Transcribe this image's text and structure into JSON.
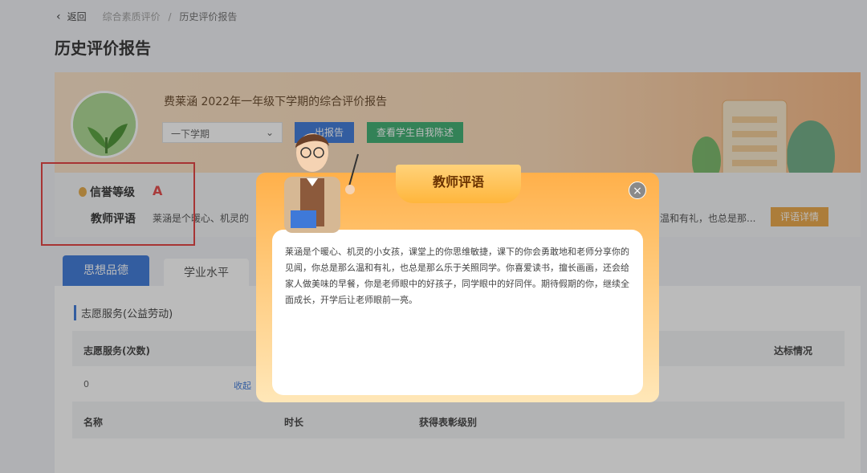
{
  "nav": {
    "back_label": "返回",
    "breadcrumb": [
      "综合素质评价",
      "历史评价报告"
    ],
    "separator": "/"
  },
  "page_title": "历史评价报告",
  "report": {
    "title": "费莱涵  2022年一年级下学期的综合评价报告",
    "semester_value": "一下学期",
    "btn_export": "出报告",
    "btn_self_statement": "查看学生自我陈述"
  },
  "credit": {
    "label": "信誉等级",
    "value": "A"
  },
  "teacher_comment": {
    "label": "教师评语",
    "preview": "莱涵是个暖心、机灵的",
    "preview_tail": "温和有礼，也总是那...",
    "detail_button": "评语详情"
  },
  "tabs": [
    "思想品德",
    "学业水平"
  ],
  "section": {
    "title": "志愿服务(公益劳动)",
    "table1": {
      "headers": [
        "志愿服务(次数)",
        "达标情况"
      ],
      "row": [
        "0",
        "收起"
      ]
    },
    "table2": {
      "headers": [
        "名称",
        "时长",
        "获得表彰级别"
      ]
    }
  },
  "modal": {
    "title": "教师评语",
    "close": "×",
    "text": "莱涵是个暖心、机灵的小女孩，课堂上的你思维敏捷，课下的你会勇敢地和老师分享你的见闻，你总是那么温和有礼，也总是那么乐于关照同学。你喜爱读书，擅长画画，还会给家人做美味的早餐，你是老师眼中的好孩子，同学眼中的好同伴。期待假期的你，继续全面成长，开学后让老师眼前一亮。"
  },
  "colors": {
    "primary": "#2f6fd6",
    "green": "#2fa866",
    "orange": "#e8a03a",
    "danger": "#e23b3b"
  }
}
